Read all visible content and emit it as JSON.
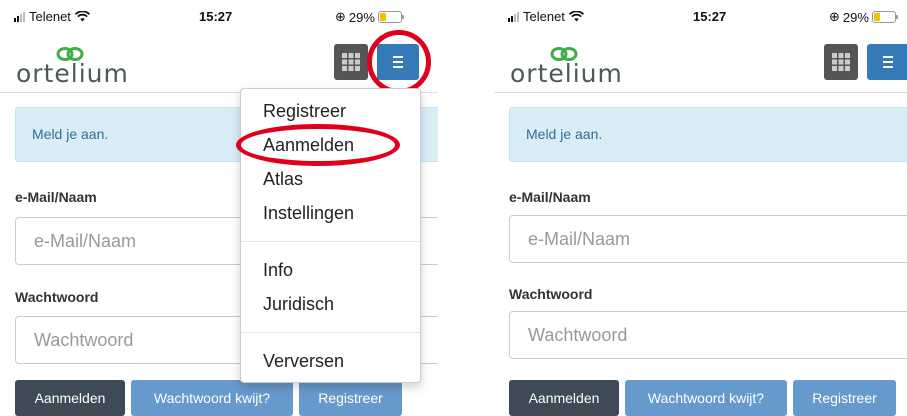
{
  "status_bar": {
    "carrier": "Telenet",
    "time": "15:27",
    "battery": "29%",
    "battery_level": 0.29
  },
  "brand": {
    "logo_text": "ortelium"
  },
  "header": {
    "grid_icon": "grid-icon",
    "menu_icon": "hamburger-icon"
  },
  "alert": {
    "text": "Meld je aan."
  },
  "form": {
    "email_label": "e-Mail/Naam",
    "email_placeholder": "e-Mail/Naam",
    "password_label": "Wachtwoord",
    "password_placeholder": "Wachtwoord"
  },
  "buttons": {
    "login": "Aanmelden",
    "forgot": "Wachtwoord kwijt?",
    "register": "Registreer"
  },
  "menu": {
    "items": [
      "Registreer",
      "Aanmelden",
      "Atlas",
      "Instellingen",
      "Info",
      "Juridisch",
      "Verversen"
    ]
  },
  "colors": {
    "primary": "#337ab7",
    "highlight": "#e0001b",
    "alert_bg": "#d9edf7",
    "dark_button": "#3e4a55",
    "light_button": "#6699cc"
  }
}
